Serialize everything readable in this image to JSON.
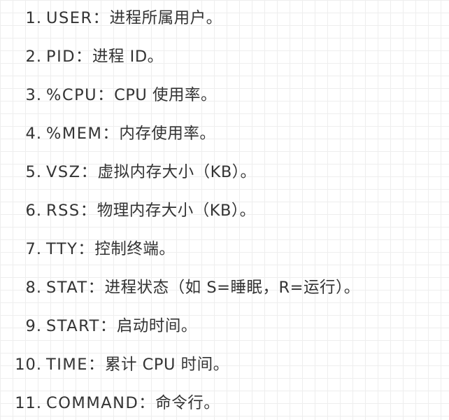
{
  "items": [
    {
      "num": "1.",
      "term": "USER：",
      "desc": "进程所属用户。"
    },
    {
      "num": "2.",
      "term": "PID：",
      "desc": "进程 ID。"
    },
    {
      "num": "3.",
      "term": "%CPU：",
      "desc": "CPU 使用率。"
    },
    {
      "num": "4.",
      "term": "%MEM：",
      "desc": "内存使用率。"
    },
    {
      "num": "5.",
      "term": "VSZ：",
      "desc": "虚拟内存大小（KB）。"
    },
    {
      "num": "6.",
      "term": "RSS：",
      "desc": "物理内存大小（KB）。"
    },
    {
      "num": "7.",
      "term": "TTY：",
      "desc": "控制终端。"
    },
    {
      "num": "8.",
      "term": "STAT：",
      "desc": "进程状态（如 S=睡眠，R=运行）。"
    },
    {
      "num": "9.",
      "term": "START：",
      "desc": "启动时间。"
    },
    {
      "num": "10.",
      "term": "TIME：",
      "desc": "累计 CPU 时间。"
    },
    {
      "num": "11.",
      "term": "COMMAND：",
      "desc": "命令行。"
    }
  ]
}
